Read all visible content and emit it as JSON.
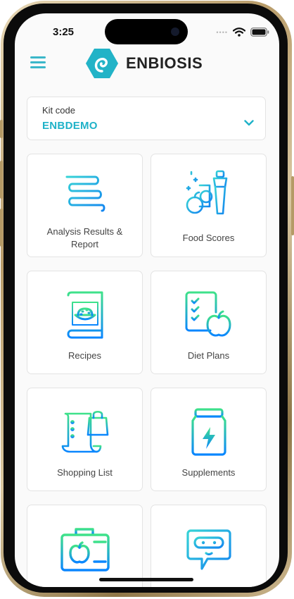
{
  "status_bar": {
    "time": "3:25",
    "signal_dots": "••••"
  },
  "header": {
    "brand_name": "ENBIOSIS"
  },
  "kit": {
    "label": "Kit code",
    "value": "ENBDEMO"
  },
  "tiles": [
    {
      "label": "Analysis Results & Report",
      "icon": "intestine-icon"
    },
    {
      "label": "Food Scores",
      "icon": "fruit-shaker-icon"
    },
    {
      "label": "Recipes",
      "icon": "recipe-book-icon"
    },
    {
      "label": "Diet Plans",
      "icon": "diet-checklist-icon"
    },
    {
      "label": "Shopping List",
      "icon": "shopping-list-icon"
    },
    {
      "label": "Supplements",
      "icon": "supplement-jar-icon"
    },
    {
      "label": "",
      "icon": "camera-fruit-icon"
    },
    {
      "label": "",
      "icon": "chat-bot-icon"
    }
  ],
  "colors": {
    "accent": "#1fb2c8",
    "gradient_start": "#3fe28a",
    "gradient_end": "#0a86ff"
  }
}
